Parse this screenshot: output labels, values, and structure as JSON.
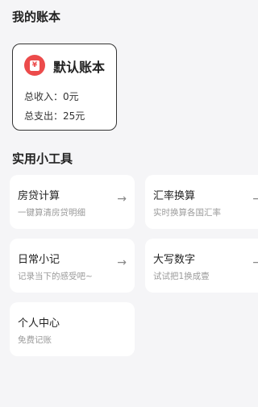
{
  "header": {
    "my_books_title": "我的账本",
    "tools_title": "实用小工具"
  },
  "account_book": {
    "icon": "ledger-icon",
    "icon_glyph": "¥",
    "icon_color": "#ec4b4b",
    "name": "默认账本",
    "income_label": "总收入：",
    "income_value": "0元",
    "expense_label": "总支出：",
    "expense_value": "25元"
  },
  "tools": [
    {
      "name": "房贷计算",
      "desc": "一键算清房贷明细",
      "arrow": "→"
    },
    {
      "name": "汇率换算",
      "desc": "实时换算各国汇率",
      "arrow": "→"
    },
    {
      "name": "日常小记",
      "desc": "记录当下的感受吧~",
      "arrow": "→"
    },
    {
      "name": "大写数字",
      "desc": "试试把1换成壹",
      "arrow": "→"
    },
    {
      "name": "个人中心",
      "desc": "免费记账"
    }
  ]
}
